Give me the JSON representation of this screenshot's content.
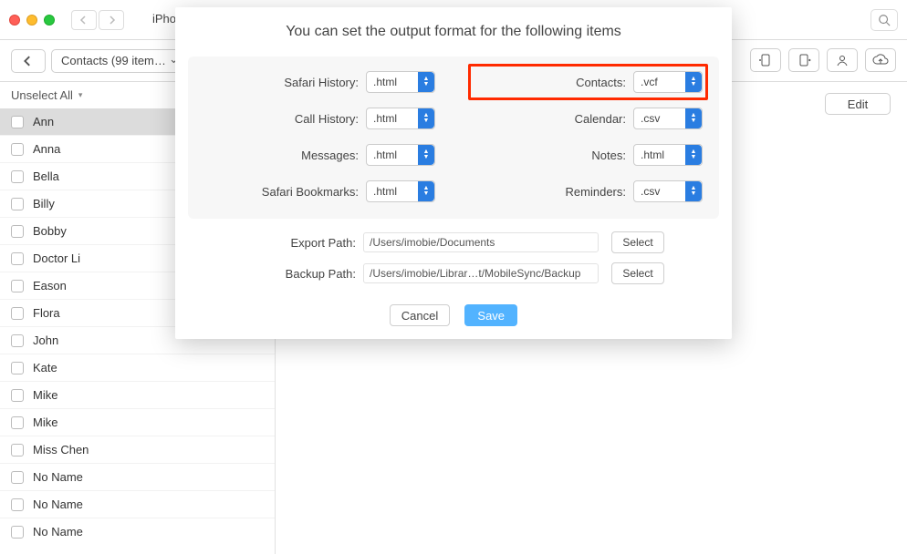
{
  "titlebar": {
    "device_name": "iPhone"
  },
  "toolbar": {
    "breadcrumb": "Contacts (99 item…"
  },
  "sidebar": {
    "select_all_label": "Unselect All",
    "contacts": [
      {
        "name": "Ann",
        "selected": true
      },
      {
        "name": "Anna",
        "selected": false
      },
      {
        "name": "Bella",
        "selected": false
      },
      {
        "name": "Billy",
        "selected": false
      },
      {
        "name": "Bobby",
        "selected": false
      },
      {
        "name": "Doctor Li",
        "selected": false
      },
      {
        "name": "Eason",
        "selected": false
      },
      {
        "name": "Flora",
        "selected": false
      },
      {
        "name": "John",
        "selected": false
      },
      {
        "name": "Kate",
        "selected": false
      },
      {
        "name": "Mike",
        "selected": false
      },
      {
        "name": "Mike",
        "selected": false
      },
      {
        "name": "Miss Chen",
        "selected": false
      },
      {
        "name": "No Name",
        "selected": false
      },
      {
        "name": "No Name",
        "selected": false
      },
      {
        "name": "No Name",
        "selected": false
      }
    ]
  },
  "content": {
    "edit_label": "Edit"
  },
  "modal": {
    "title": "You can set the output format for the following items",
    "formats": {
      "safari_history": {
        "label": "Safari History:",
        "value": ".html"
      },
      "contacts": {
        "label": "Contacts:",
        "value": ".vcf"
      },
      "call_history": {
        "label": "Call History:",
        "value": ".html"
      },
      "calendar": {
        "label": "Calendar:",
        "value": ".csv"
      },
      "messages": {
        "label": "Messages:",
        "value": ".html"
      },
      "notes": {
        "label": "Notes:",
        "value": ".html"
      },
      "safari_bookmarks": {
        "label": "Safari Bookmarks:",
        "value": ".html"
      },
      "reminders": {
        "label": "Reminders:",
        "value": ".csv"
      }
    },
    "export_path": {
      "label": "Export Path:",
      "value": "/Users/imobie/Documents",
      "button": "Select"
    },
    "backup_path": {
      "label": "Backup Path:",
      "value": "/Users/imobie/Librar…t/MobileSync/Backup",
      "button": "Select"
    },
    "cancel_label": "Cancel",
    "save_label": "Save"
  }
}
